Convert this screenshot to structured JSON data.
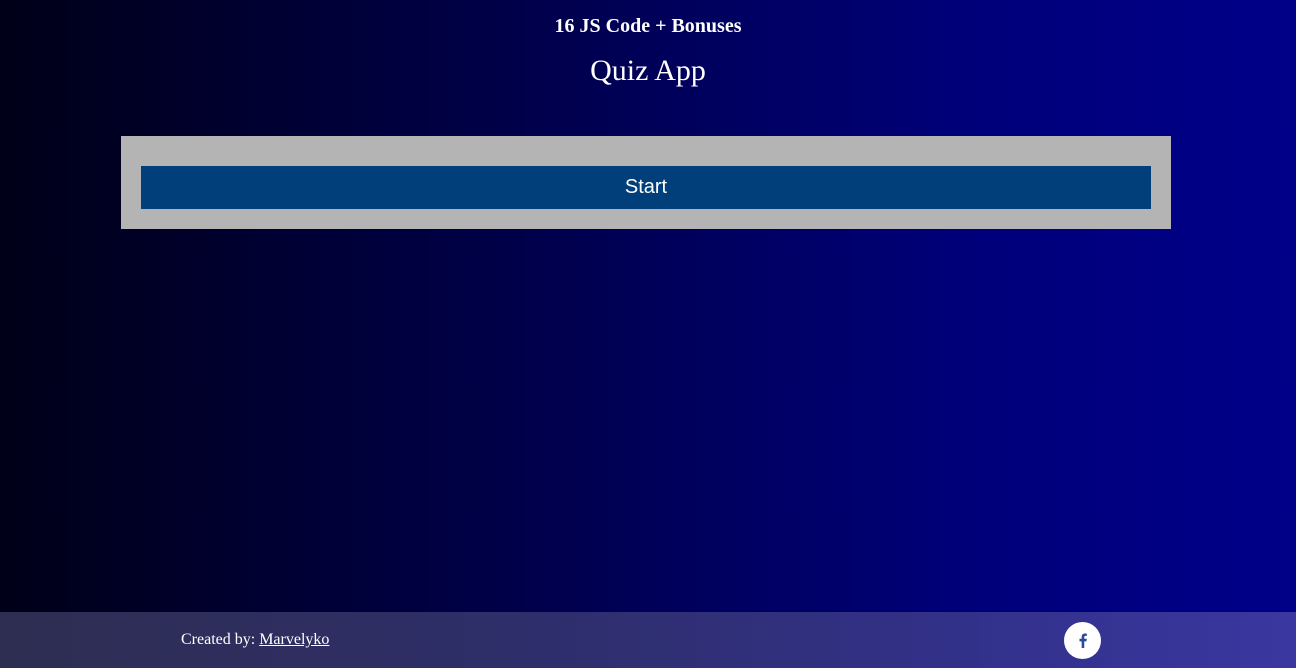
{
  "header": {
    "site_title": "16 JS Code + Bonuses",
    "app_title": "Quiz App"
  },
  "quiz": {
    "start_label": "Start"
  },
  "footer": {
    "credit_prefix": "Created by: ",
    "author_name": "Marvelyko",
    "social_icon": "facebook-icon"
  },
  "colors": {
    "panel": "#b4b4b4",
    "start_button": "#003f7a",
    "background_left": "#000018",
    "background_right": "#000088",
    "facebook_icon": "#2d4a96"
  }
}
